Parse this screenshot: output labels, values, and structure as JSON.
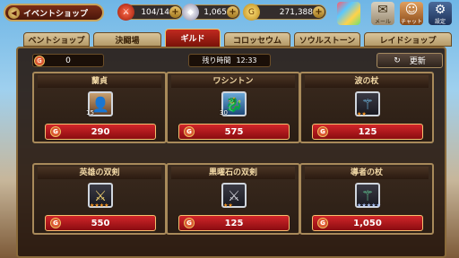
{
  "topbar": {
    "back_label": "イベントショップ",
    "stamina": "104/14",
    "gems": "1,065",
    "gold": "271,388",
    "mail_label": "メール",
    "chat_label": "チャット",
    "settings_label": "設定"
  },
  "tabs": [
    "ベントショップ",
    "決闘場",
    "ギルド",
    "コロッセウム",
    "ソウルストーン",
    "レイドショップ"
  ],
  "active_tab": "ギルド",
  "panel": {
    "guild_coins": "0",
    "timer_label": "残り時間",
    "timer_value": "12:33",
    "refresh_label": "更新"
  },
  "items": [
    {
      "name": "蘭貞",
      "price": "290",
      "level": "15",
      "icon": "hero-portrait-icon"
    },
    {
      "name": "ワシントン",
      "price": "575",
      "level": "30",
      "icon": "dragon-portrait-icon"
    },
    {
      "name": "波の杖",
      "price": "125",
      "stars": "★★",
      "icon": "staff-icon"
    },
    {
      "name": "英雄の双剣",
      "price": "550",
      "stars": "★★★★",
      "icon": "twin-swords-icon"
    },
    {
      "name": "黒曜石の双剣",
      "price": "125",
      "stars": "★★",
      "icon": "obsidian-swords-icon"
    },
    {
      "name": "導者の杖",
      "price": "1,050",
      "stars": "★★★★★",
      "icon": "guide-staff-icon"
    }
  ],
  "colors": {
    "accent_red": "#c12a20",
    "gold_border": "#d8b36a"
  }
}
